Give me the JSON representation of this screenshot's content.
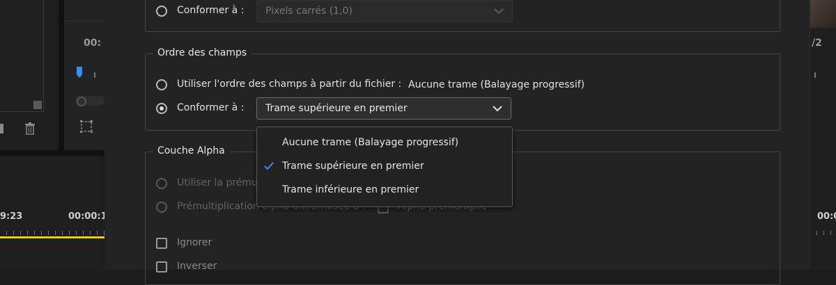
{
  "background_left": {
    "timecode_top": "00:",
    "timecode_left": "9:23",
    "timecode_mid": "00:00:1"
  },
  "background_right": {
    "fragment_top": "/2",
    "timecode": "00:0"
  },
  "top_group": {
    "conform_label": "Conformer à :",
    "pixel_aspect_value": "Pixels carrés (1,0)"
  },
  "field_order": {
    "title": "Ordre des champs",
    "use_file_label": "Utiliser l'ordre des champs à partir du fichier :",
    "use_file_value": "Aucune trame (Balayage progressif)",
    "conform_label": "Conformer à :",
    "conform_value": "Trame supérieure en premier",
    "options": [
      "Aucune trame (Balayage progressif)",
      "Trame supérieure en premier",
      "Trame inférieure en premier"
    ],
    "selected_index": 1
  },
  "alpha": {
    "title": "Couche Alpha",
    "use_premult_label": "Utiliser la prému",
    "premult_uniform_label": "Prémultiplication alpha uniformisée à :",
    "alpha_premult_label": "Alpha prémultiplié",
    "ignore_label": "Ignorer",
    "invert_label": "Inverser"
  },
  "colors": {
    "accent_check": "#3b8ef0",
    "playhead": "#3b8ef0",
    "timeline_line": "#e8d400"
  }
}
